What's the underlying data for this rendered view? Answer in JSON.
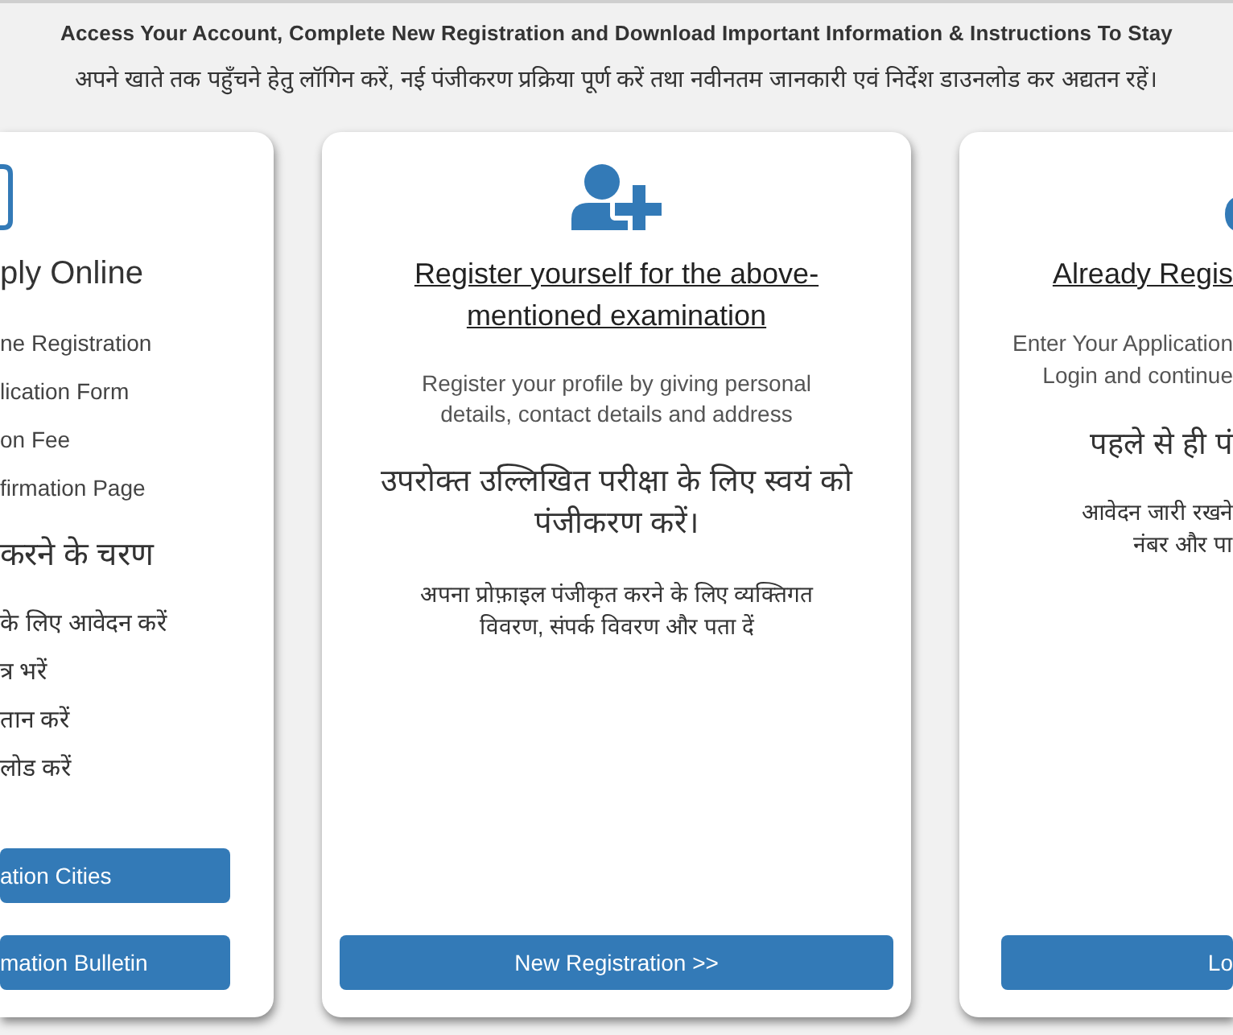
{
  "header": {
    "title": "Access Your Account, Complete New Registration and Download Important Information & Instructions To Stay",
    "subtitle": "अपने खाते तक पहुँचने हेतु लॉगिन करें, नई पंजीकरण प्रक्रिया पूर्ण करें तथा नवीनतम जानकारी एवं निर्देश डाउनलोड कर अद्यतन रहें।"
  },
  "cards": [
    {
      "kind": "steps",
      "heading": "ply Online",
      "steps": [
        "ne Registration",
        "lication Form",
        "on Fee",
        "firmation Page"
      ],
      "hindi_heading": "करने के चरण",
      "hindi_steps": [
        "के लिए आवेदन करें",
        "त्र भरें",
        "तान करें",
        "लोड करें"
      ],
      "buttons": [
        "ation Cities",
        "mation Bulletin"
      ]
    },
    {
      "kind": "register",
      "heading": "Register yourself for the above-mentioned examination",
      "description": "Register your profile by giving personal details, contact details and address",
      "hindi_heading": "उपरोक्त उल्लिखित परीक्षा के लिए स्वयं को पंजीकरण करें।",
      "hindi_description": "अपना प्रोफ़ाइल पंजीकृत करने के लिए व्यक्तिगत विवरण, संपर्क विवरण और पता दें",
      "buttons": [
        "New Registration >>"
      ]
    },
    {
      "kind": "login",
      "heading": "Already Regis",
      "description_lines": [
        "Enter Your Application",
        "Login and continue"
      ],
      "hindi_heading": "पहले से ही पं",
      "hindi_description_lines": [
        "आवेदन जारी रखने",
        "नंबर और पा"
      ],
      "buttons": [
        "Lo"
      ]
    }
  ]
}
